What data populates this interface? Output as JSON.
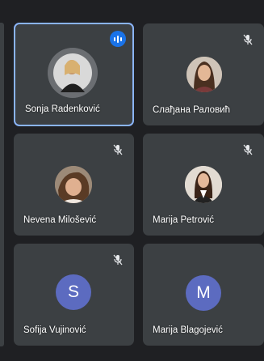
{
  "participants": [
    {
      "name": "Sonja Radenković",
      "avatar_type": "photo",
      "mic": "speaking",
      "active": true
    },
    {
      "name": "Слађана Раловић",
      "avatar_type": "photo",
      "mic": "muted",
      "active": false
    },
    {
      "name": "Nevena Milošević",
      "avatar_type": "photo",
      "mic": "muted",
      "active": false
    },
    {
      "name": "Marija Petrović",
      "avatar_type": "photo",
      "mic": "muted",
      "active": false
    },
    {
      "name": "Sofija Vujinović",
      "avatar_type": "letter",
      "initial": "S",
      "avatar_color": "#5c6bc0",
      "mic": "muted",
      "active": false
    },
    {
      "name": "Marija Blagojević",
      "avatar_type": "letter",
      "initial": "M",
      "avatar_color": "#5c6bc0",
      "mic": "none",
      "active": false
    }
  ],
  "colors": {
    "background": "#1f2023",
    "tile": "#3c4043",
    "active_border": "#8ab4f8",
    "speaking_badge": "#1a73e8",
    "muted_icon": "#e8eaed"
  },
  "icons": {
    "muted": "mic-off-icon",
    "speaking": "audio-level-icon"
  }
}
